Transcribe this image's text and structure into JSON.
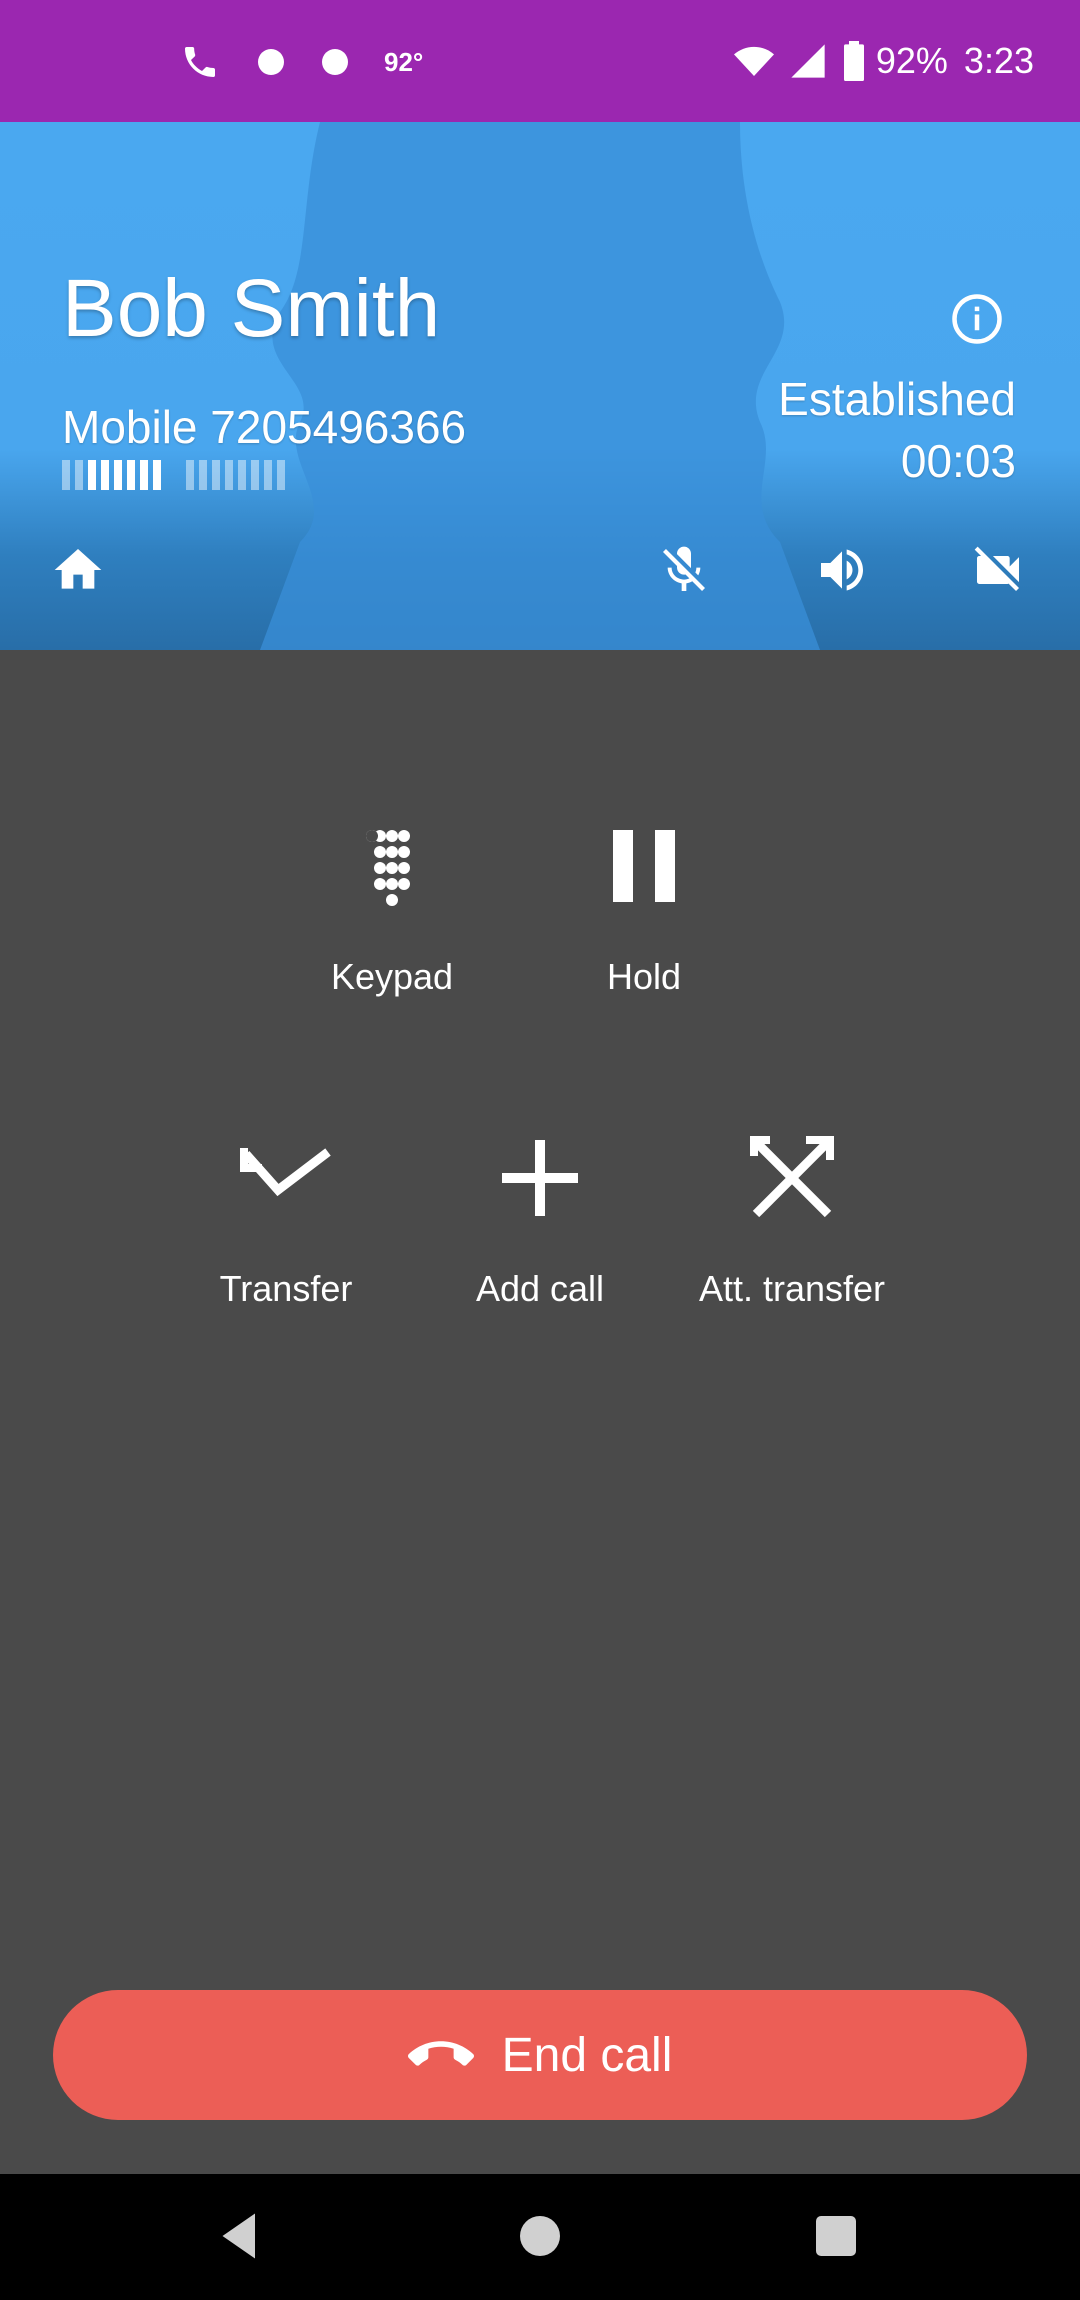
{
  "status_bar": {
    "temperature": "92°",
    "battery": "92%",
    "time": "3:23",
    "icons": [
      "phone-icon",
      "dot-icon",
      "dot-icon",
      "wifi-icon",
      "cell-signal-icon",
      "battery-icon"
    ]
  },
  "call": {
    "name": "Bob Smith",
    "number": "Mobile 7205496366",
    "state": "Established",
    "timer": "00:03",
    "signal_bars": {
      "group1_on": 6,
      "group1_total": 8,
      "group2_on": 0,
      "group2_total": 8
    }
  },
  "header_icons": [
    "home-icon",
    "mic-off-icon",
    "speaker-icon",
    "video-off-icon",
    "info-icon"
  ],
  "actions": {
    "keypad": "Keypad",
    "hold": "Hold",
    "transfer": "Transfer",
    "add_call": "Add call",
    "att_transfer": "Att. transfer"
  },
  "end_call": {
    "label": "End call",
    "icon": "hang-up-icon"
  },
  "colors": {
    "status_bar": "#9b27b0",
    "header": "#4aa8f0",
    "background": "#4a4a4a",
    "end_call": "#ec5e56"
  },
  "nav_bar": [
    "back-icon",
    "home-circle-icon",
    "recents-icon"
  ]
}
